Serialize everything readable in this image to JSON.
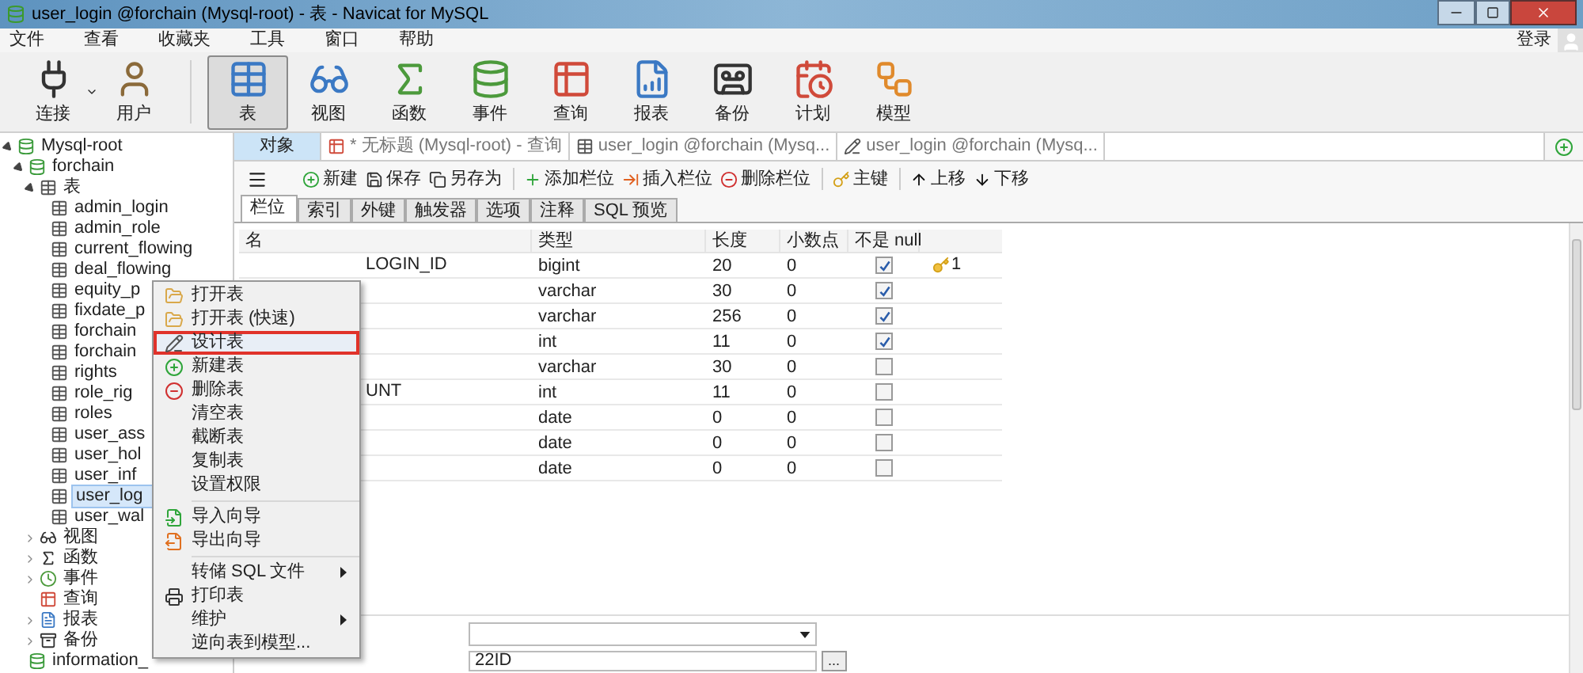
{
  "window": {
    "title": "user_login @forchain (Mysql-root) - 表 - Navicat for MySQL"
  },
  "menu_bar": {
    "items": [
      "文件",
      "查看",
      "收藏夹",
      "工具",
      "窗口",
      "帮助"
    ],
    "login": "登录"
  },
  "toolbar": {
    "groups": [
      [
        {
          "label": "连接",
          "selected": false,
          "dropdown": true
        },
        {
          "label": "用户",
          "selected": false,
          "dropdown": false
        }
      ],
      [
        {
          "label": "表",
          "selected": true,
          "dropdown": false
        },
        {
          "label": "视图",
          "selected": false,
          "dropdown": false
        },
        {
          "label": "函数",
          "selected": false,
          "dropdown": false
        },
        {
          "label": "事件",
          "selected": false,
          "dropdown": false
        },
        {
          "label": "查询",
          "selected": false,
          "dropdown": false
        },
        {
          "label": "报表",
          "selected": false,
          "dropdown": false
        },
        {
          "label": "备份",
          "selected": false,
          "dropdown": false
        },
        {
          "label": "计划",
          "selected": false,
          "dropdown": false
        },
        {
          "label": "模型",
          "selected": false,
          "dropdown": false
        }
      ]
    ]
  },
  "sidebar": {
    "tree": [
      {
        "label": "Mysql-root",
        "kind": "connection",
        "expanded": true,
        "selected": false,
        "children": [
          {
            "label": "forchain",
            "kind": "database",
            "expanded": true,
            "selected": false,
            "children": [
              {
                "label": "表",
                "kind": "tables",
                "expanded": true,
                "selected": false,
                "children": [
                  {
                    "label": "admin_login",
                    "kind": "table",
                    "selected": false
                  },
                  {
                    "label": "admin_role",
                    "kind": "table",
                    "selected": false
                  },
                  {
                    "label": "current_flowing",
                    "kind": "table",
                    "selected": false
                  },
                  {
                    "label": "deal_flowing",
                    "kind": "table",
                    "selected": false
                  },
                  {
                    "label": "equity_p",
                    "kind": "table",
                    "selected": false
                  },
                  {
                    "label": "fixdate_p",
                    "kind": "table",
                    "selected": false
                  },
                  {
                    "label": "forchain",
                    "kind": "table",
                    "selected": false
                  },
                  {
                    "label": "forchain",
                    "kind": "table",
                    "selected": false
                  },
                  {
                    "label": "rights",
                    "kind": "table",
                    "selected": false
                  },
                  {
                    "label": "role_rig",
                    "kind": "table",
                    "selected": false
                  },
                  {
                    "label": "roles",
                    "kind": "table",
                    "selected": false
                  },
                  {
                    "label": "user_ass",
                    "kind": "table",
                    "selected": false
                  },
                  {
                    "label": "user_hol",
                    "kind": "table",
                    "selected": false
                  },
                  {
                    "label": "user_inf",
                    "kind": "table",
                    "selected": false
                  },
                  {
                    "label": "user_log",
                    "kind": "table",
                    "selected": true
                  },
                  {
                    "label": "user_wal",
                    "kind": "table",
                    "selected": false
                  }
                ]
              },
              {
                "label": "视图",
                "kind": "views",
                "expanded": false,
                "selected": false
              },
              {
                "label": "函数",
                "kind": "functions",
                "expanded": false,
                "selected": false
              },
              {
                "label": "事件",
                "kind": "events",
                "expanded": false,
                "selected": false
              },
              {
                "label": "查询",
                "kind": "queries",
                "selected": false
              },
              {
                "label": "报表",
                "kind": "reports",
                "expanded": false,
                "selected": false
              },
              {
                "label": "备份",
                "kind": "backups",
                "expanded": false,
                "selected": false
              }
            ]
          },
          {
            "label": "information_",
            "kind": "database",
            "selected": false
          }
        ]
      }
    ]
  },
  "tabs": [
    {
      "label": "对象",
      "kind": "objects",
      "selected": true
    },
    {
      "label": "* 无标题 (Mysql-root) - 查询",
      "kind": "query",
      "selected": false
    },
    {
      "label": "user_login @forchain (Mysq...",
      "kind": "table",
      "selected": false
    },
    {
      "label": "user_login @forchain (Mysq...",
      "kind": "design",
      "selected": false
    }
  ],
  "design_toolbar": {
    "items": [
      {
        "label": "新建",
        "kind": "new"
      },
      {
        "label": "保存",
        "kind": "save"
      },
      {
        "label": "另存为",
        "kind": "saveas"
      },
      {
        "label": "添加栏位",
        "kind": "add"
      },
      {
        "label": "插入栏位",
        "kind": "insert"
      },
      {
        "label": "删除栏位",
        "kind": "delete"
      },
      {
        "label": "主键",
        "kind": "key"
      },
      {
        "label": "上移",
        "kind": "up"
      },
      {
        "label": "下移",
        "kind": "down"
      }
    ]
  },
  "sub_tabs": [
    {
      "label": "栏位",
      "selected": true
    },
    {
      "label": "索引",
      "selected": false
    },
    {
      "label": "外键",
      "selected": false
    },
    {
      "label": "触发器",
      "selected": false
    },
    {
      "label": "选项",
      "selected": false
    },
    {
      "label": "注释",
      "selected": false
    },
    {
      "label": "SQL 预览",
      "selected": false
    }
  ],
  "table": {
    "columns": [
      "名",
      "类型",
      "长度",
      "小数点",
      "不是 null"
    ],
    "rows": [
      {
        "name": "LOGIN_ID",
        "type": "bigint",
        "length": "20",
        "decimals": "0",
        "not_null": true,
        "key": "1"
      },
      {
        "type": "varchar",
        "length": "30",
        "decimals": "0",
        "not_null": true
      },
      {
        "type": "varchar",
        "length": "256",
        "decimals": "0",
        "not_null": true
      },
      {
        "type": "int",
        "length": "11",
        "decimals": "0",
        "not_null": true
      },
      {
        "type": "varchar",
        "length": "30",
        "decimals": "0",
        "not_null": false
      },
      {
        "name": "UNT",
        "type": "int",
        "length": "11",
        "decimals": "0",
        "not_null": false
      },
      {
        "type": "date",
        "length": "0",
        "decimals": "0",
        "not_null": false
      },
      {
        "type": "date",
        "length": "0",
        "decimals": "0",
        "not_null": false
      },
      {
        "type": "date",
        "length": "0",
        "decimals": "0",
        "not_null": false
      }
    ]
  },
  "properties": {
    "field": {
      "value": "22ID"
    },
    "browse_button": "..."
  },
  "context_menu": {
    "items": [
      {
        "kind": "item",
        "label": "打开表",
        "icon": true,
        "submenu": false,
        "selected": false
      },
      {
        "kind": "item",
        "label": "打开表 (快速)",
        "icon": true,
        "submenu": false,
        "selected": false
      },
      {
        "kind": "item",
        "label": "设计表",
        "icon": true,
        "submenu": false,
        "selected": true
      },
      {
        "kind": "item",
        "label": "新建表",
        "icon": true,
        "submenu": false,
        "selected": false
      },
      {
        "kind": "item",
        "label": "删除表",
        "icon": true,
        "submenu": false,
        "selected": false
      },
      {
        "kind": "item",
        "label": "清空表",
        "icon": false,
        "submenu": false,
        "selected": false
      },
      {
        "kind": "item",
        "label": "截断表",
        "icon": false,
        "submenu": false,
        "selected": false
      },
      {
        "kind": "item",
        "label": "复制表",
        "icon": false,
        "submenu": false,
        "selected": false
      },
      {
        "kind": "item",
        "label": "设置权限",
        "icon": false,
        "submenu": false,
        "selected": false
      },
      {
        "kind": "separator"
      },
      {
        "kind": "item",
        "label": "导入向导",
        "icon": true,
        "submenu": false,
        "selected": false
      },
      {
        "kind": "item",
        "label": "导出向导",
        "icon": true,
        "submenu": false,
        "selected": false
      },
      {
        "kind": "separator"
      },
      {
        "kind": "item",
        "label": "转储 SQL 文件",
        "icon": false,
        "submenu": true,
        "selected": false
      },
      {
        "kind": "item",
        "label": "打印表",
        "icon": true,
        "submenu": false,
        "selected": false
      },
      {
        "kind": "item",
        "label": "维护",
        "icon": false,
        "submenu": true,
        "selected": false
      },
      {
        "kind": "item",
        "label": "逆向表到模型...",
        "icon": false,
        "submenu": false,
        "selected": false
      }
    ]
  }
}
